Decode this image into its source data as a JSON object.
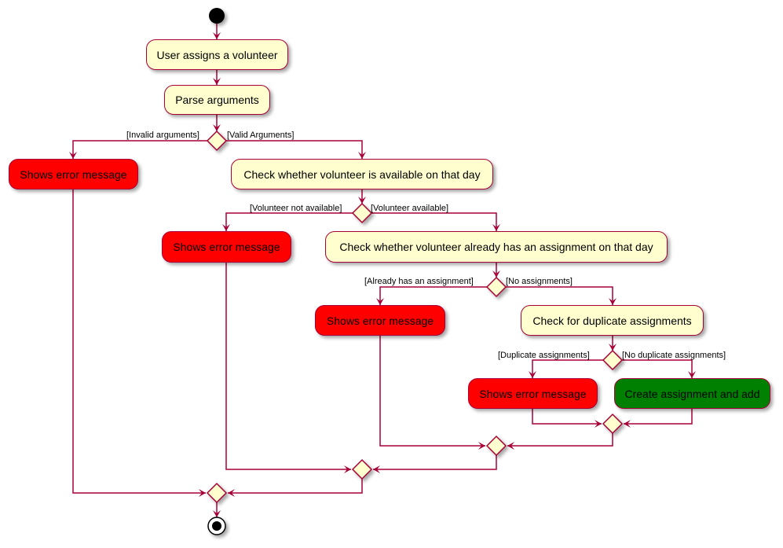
{
  "diagram": {
    "type": "activity",
    "colors": {
      "line": "#A80036",
      "activity_fill": "#FEFECE",
      "error_fill": "#FF0000",
      "success_fill": "#008000",
      "node_fill": "#000000"
    },
    "activities": {
      "user_assigns": "User assigns a volunteer",
      "parse_args": "Parse arguments",
      "error_1": "Shows error message",
      "check_available": "Check whether volunteer is available on that day",
      "error_2": "Shows error message",
      "check_existing": "Check whether volunteer already has an assignment on that day",
      "error_3": "Shows error message",
      "check_duplicate": "Check for duplicate assignments",
      "error_4": "Shows error message",
      "create_add": "Create assignment and add"
    },
    "guards": {
      "invalid_args": "[Invalid arguments]",
      "valid_args": "[Valid Arguments]",
      "not_available": "[Volunteer not available]",
      "available": "[Volunteer available]",
      "already_assigned": "[Already has an assignment]",
      "no_assignments": "[No assignments]",
      "duplicate": "[Duplicate assignments]",
      "no_duplicate": "[No duplicate assignments]"
    }
  }
}
